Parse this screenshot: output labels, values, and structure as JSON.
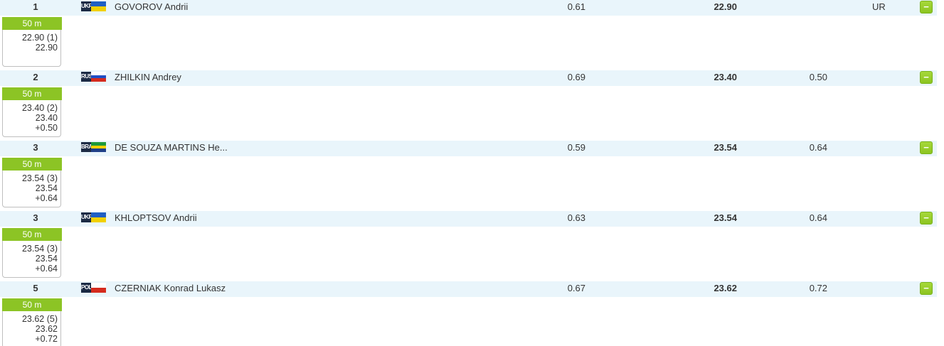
{
  "results": [
    {
      "rank": "1",
      "country": "UKR",
      "flag_colors": [
        "#1f5fc4",
        "#f1d000"
      ],
      "name": "GOVOROV Andrii",
      "reaction": "0.61",
      "time": "22.90",
      "behind": "",
      "record": "UR",
      "toggle": "−",
      "split": {
        "distance": "50 m",
        "lines": [
          "22.90 (1)",
          "22.90"
        ]
      }
    },
    {
      "rank": "2",
      "country": "RUS",
      "flag_colors": [
        "#ffffff",
        "#1f4fc4",
        "#d52b1e"
      ],
      "name": "ZHILKIN Andrey",
      "reaction": "0.69",
      "time": "23.40",
      "behind": "0.50",
      "record": "",
      "toggle": "−",
      "split": {
        "distance": "50 m",
        "lines": [
          "23.40 (2)",
          "23.40",
          "+0.50"
        ]
      }
    },
    {
      "rank": "3",
      "country": "BRA",
      "flag_colors": [
        "#1e9a3a",
        "#f1d000",
        "#1e3f8a"
      ],
      "name": "DE SOUZA MARTINS He...",
      "reaction": "0.59",
      "time": "23.54",
      "behind": "0.64",
      "record": "",
      "toggle": "−",
      "split": {
        "distance": "50 m",
        "lines": [
          "23.54 (3)",
          "23.54",
          "+0.64"
        ]
      }
    },
    {
      "rank": "3",
      "country": "UKR",
      "flag_colors": [
        "#1f5fc4",
        "#f1d000"
      ],
      "name": "KHLOPTSOV Andrii",
      "reaction": "0.63",
      "time": "23.54",
      "behind": "0.64",
      "record": "",
      "toggle": "−",
      "split": {
        "distance": "50 m",
        "lines": [
          "23.54 (3)",
          "23.54",
          "+0.64"
        ]
      }
    },
    {
      "rank": "5",
      "country": "POL",
      "flag_colors": [
        "#ffffff",
        "#d52b1e"
      ],
      "name": "CZERNIAK Konrad Lukasz",
      "reaction": "0.67",
      "time": "23.62",
      "behind": "0.72",
      "record": "",
      "toggle": "−",
      "split": {
        "distance": "50 m",
        "lines": [
          "23.62 (5)",
          "23.62",
          "+0.72"
        ]
      }
    }
  ],
  "colors": {
    "row_background": "#e9f5fb",
    "accent_green": "#8cc425",
    "border": "#bfbfbf"
  }
}
